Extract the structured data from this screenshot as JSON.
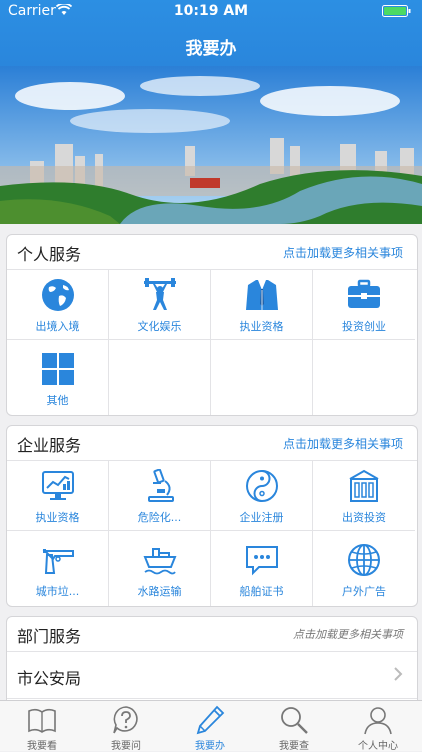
{
  "status_bar": {
    "carrier": "Carrier",
    "time": "10:19 AM"
  },
  "header": {
    "title": "我要办"
  },
  "personal": {
    "title": "个人服务",
    "more": "点击加载更多相关事项",
    "items": [
      {
        "label": "出境入境",
        "icon": "globe-icon"
      },
      {
        "label": "文化娱乐",
        "icon": "weightlifter-icon"
      },
      {
        "label": "执业资格",
        "icon": "suit-icon"
      },
      {
        "label": "投资创业",
        "icon": "briefcase-icon"
      },
      {
        "label": "其他",
        "icon": "grid-icon"
      }
    ]
  },
  "enterprise": {
    "title": "企业服务",
    "more": "点击加载更多相关事项",
    "items": [
      {
        "label": "执业资格",
        "icon": "chart-monitor-icon"
      },
      {
        "label": "危险化...",
        "icon": "microscope-icon"
      },
      {
        "label": "企业注册",
        "icon": "yin-yang-icon"
      },
      {
        "label": "出资投资",
        "icon": "building-icon"
      },
      {
        "label": "城市垃...",
        "icon": "gun-icon"
      },
      {
        "label": "水路运输",
        "icon": "ship-icon"
      },
      {
        "label": "船舶证书",
        "icon": "chat-bubble-icon"
      },
      {
        "label": "户外广告",
        "icon": "globe-outline-icon"
      }
    ]
  },
  "department": {
    "title": "部门服务",
    "more": "点击加载更多相关事项",
    "items": [
      {
        "label": "市公安局"
      }
    ]
  },
  "tabbar": {
    "tabs": [
      {
        "label": "我要看",
        "icon": "book-icon"
      },
      {
        "label": "我要问",
        "icon": "question-icon"
      },
      {
        "label": "我要办",
        "icon": "pencil-icon",
        "active": true
      },
      {
        "label": "我要查",
        "icon": "search-icon"
      },
      {
        "label": "个人中心",
        "icon": "person-icon"
      }
    ]
  },
  "colors": {
    "accent": "#2a86dc",
    "background": "#f0f0f2"
  }
}
